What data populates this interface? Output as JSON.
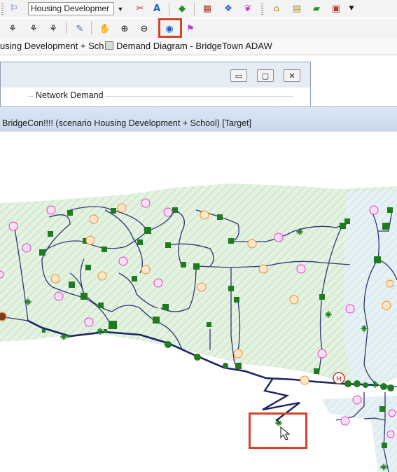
{
  "toolbar": {
    "scenario_value": "Housing Developmer",
    "scenario_dropdown_icon": "chevron-down-icon",
    "row1_icons": [
      "scenario-tree-icon",
      "pipe-red-icon",
      "annotation-a-icon",
      "layer-icon",
      "grid-icon",
      "color-code-icon",
      "demand-icon",
      "house-icon",
      "folder-icon",
      "bookmark-icon",
      "calendar-icon",
      "book-icon",
      "table-icon"
    ],
    "row2_icons": [
      "network-icon",
      "network-navigate-icon",
      "network-trace-icon",
      "wrench-icon",
      "pan-hand-icon",
      "zoom-in-icon",
      "zoom-out-icon",
      "demand-diagram-icon",
      "highlight-flag-icon"
    ],
    "highlighted_tool": "demand-diagram-icon"
  },
  "doc_tabs": {
    "tab1": "using Development + Sch",
    "tab2": "Demand Diagram - BridgeTown ADAW"
  },
  "dialog": {
    "group_label": "Network Demand",
    "minimize": "▭",
    "restore": "▢",
    "close": "✕"
  },
  "diagram": {
    "title": "BridgeCon!!!! (scenario Housing Development + School)  [Target]"
  },
  "colors": {
    "highlight": "#d0452c",
    "pipe": "#1b2466",
    "node": "#1e7d1e",
    "zone_fill": "#d6ecd3",
    "demand_orange": "#f08c2a",
    "demand_magenta": "#e23ac9"
  }
}
